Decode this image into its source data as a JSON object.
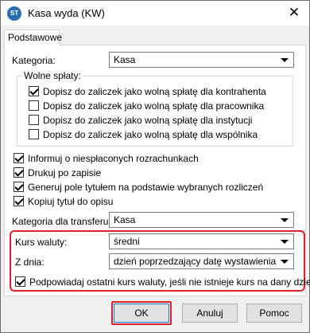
{
  "window": {
    "title": "Kasa wyda (KW)",
    "app_icon_text": "ST"
  },
  "tabs": {
    "active": "Podstawowe"
  },
  "kategoria": {
    "label": "Kategoria:",
    "value": "Kasa"
  },
  "wolne_splaty": {
    "title": "Wolne spłaty:",
    "items": [
      {
        "label": "Dopisz do zaliczek jako wolną spłatę dla kontrahenta",
        "checked": true
      },
      {
        "label": "Dopisz do zaliczek jako wolną spłatę dla pracownika",
        "checked": false
      },
      {
        "label": "Dopisz do zaliczek jako wolną spłatę dla instytucji",
        "checked": false
      },
      {
        "label": "Dopisz do zaliczek jako wolną spłatę dla wspólnika",
        "checked": false
      }
    ]
  },
  "options": [
    {
      "label": "Informuj o niespłaconych rozrachunkach",
      "checked": true
    },
    {
      "label": "Drukuj po zapisie",
      "checked": true
    },
    {
      "label": "Generuj pole tytułem na podstawie wybranych rozliczeń",
      "checked": true
    },
    {
      "label": "Kopiuj tytuł do opisu",
      "checked": true
    }
  ],
  "kategoria_transferu": {
    "label": "Kategoria dla transferu:",
    "value": "Kasa"
  },
  "kurs_waluty": {
    "label": "Kurs waluty:",
    "value": "średni"
  },
  "z_dnia": {
    "label": "Z dnia:",
    "value": "dzień poprzedzający datę wystawienia"
  },
  "podpowiadaj": {
    "label": "Podpowiadaj ostatni kurs waluty, jeśli nie istnieje kurs na dany dzień",
    "checked": true
  },
  "buttons": {
    "ok": "OK",
    "cancel": "Anuluj",
    "help": "Pomoc"
  },
  "colors": {
    "highlight": "#e0202a",
    "accent": "#0078d7"
  }
}
